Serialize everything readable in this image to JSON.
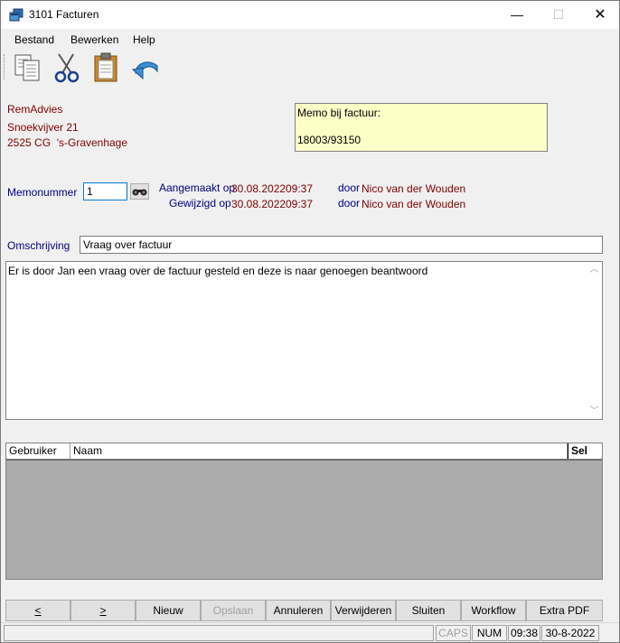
{
  "window": {
    "title": "3101 Facturen",
    "minimize": "—",
    "maximize": "☐",
    "close": "✕"
  },
  "menu": {
    "items": [
      {
        "label": "Bestand"
      },
      {
        "label": "Bewerken"
      },
      {
        "label": "Help"
      }
    ]
  },
  "toolbar": {
    "tools": [
      "copy-icon",
      "cut-icon",
      "paste-icon",
      "undo-icon"
    ]
  },
  "address": {
    "name": "RemAdvies",
    "street": "Snoekvijver 21",
    "city": "2525 CG  's-Gravenhage"
  },
  "memo_box": {
    "label": "Memo bij factuur:",
    "value": "18003/93150"
  },
  "memo": {
    "number_label": "Memonummer",
    "number_value": "1",
    "created_label": "Aangemaakt op",
    "created_date": "30.08.2022",
    "created_time": "09:37",
    "created_by_label": "door",
    "created_by": "Nico van der Wouden",
    "modified_label": "Gewijzigd op",
    "modified_date": "30.08.2022",
    "modified_time": "09:37",
    "modified_by_label": "door",
    "modified_by": "Nico van der Wouden"
  },
  "description": {
    "label": "Omschrijving",
    "value": "Vraag over factuur"
  },
  "body_text": "Er is door Jan een vraag over de factuur gesteld en deze is naar genoegen beantwoord",
  "grid": {
    "columns": [
      "Gebruiker",
      "Naam",
      "Sel"
    ]
  },
  "buttons": {
    "prev": "<",
    "next": ">",
    "new": "Nieuw",
    "save": "Opslaan",
    "cancel": "Annuleren",
    "delete": "Verwijderen",
    "close": "Sluiten",
    "workflow": "Workflow",
    "extra_pdf": "Extra PDF"
  },
  "status": {
    "caps": "CAPS",
    "num": "NUM",
    "time": "09:38",
    "date": "30-8-2022"
  }
}
